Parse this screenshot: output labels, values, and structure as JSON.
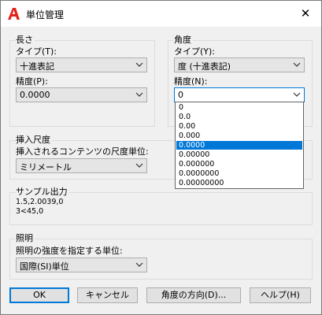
{
  "window": {
    "title": "単位管理"
  },
  "length": {
    "group_label": "長さ",
    "type_label": "タイプ(T):",
    "type_value": "十進表記",
    "precision_label": "精度(P):",
    "precision_value": "0.0000"
  },
  "angle": {
    "group_label": "角度",
    "type_label": "タイプ(Y):",
    "type_value": "度 (十進表記)",
    "precision_label": "精度(N):",
    "precision_value": "0",
    "precision_options": [
      "0",
      "0.0",
      "0.00",
      "0.000",
      "0.0000",
      "0.00000",
      "0.000000",
      "0.0000000",
      "0.00000000"
    ],
    "highlighted_option": "0.0000"
  },
  "insertion": {
    "group_label": "挿入尺度",
    "units_label": "挿入されるコンテンツの尺度単位:",
    "units_value": "ミリメートル"
  },
  "sample": {
    "group_label": "サンプル出力",
    "line1": "1.5,2.0039,0",
    "line2": "3<45,0"
  },
  "lighting": {
    "group_label": "照明",
    "units_label": "照明の強度を指定する単位:",
    "units_value": "国際(SI)単位"
  },
  "buttons": {
    "ok": "OK",
    "cancel": "キャンセル",
    "direction": "角度の方向(D)...",
    "help": "ヘルプ(H)"
  },
  "colors": {
    "accent": "#0078d7",
    "app_icon": "#e2231a"
  }
}
